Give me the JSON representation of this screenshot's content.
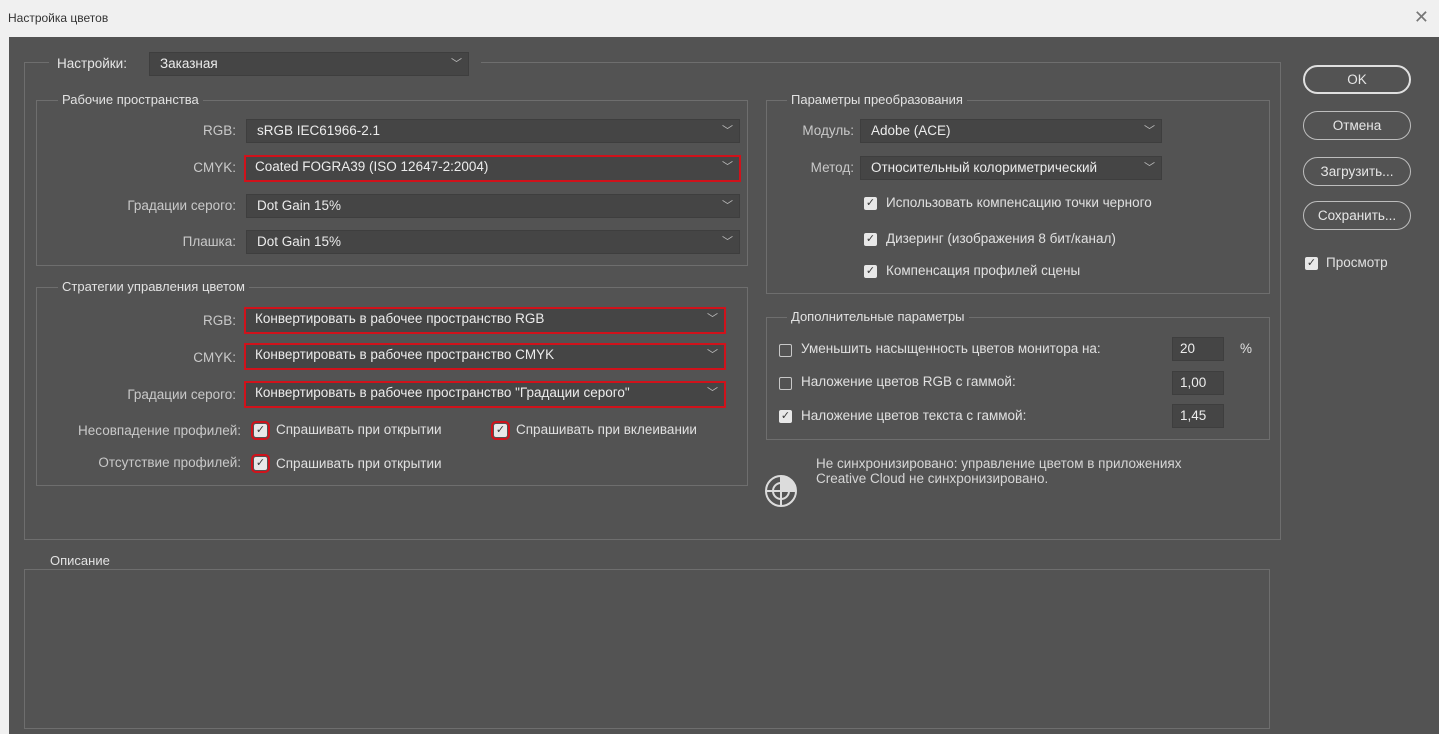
{
  "window": {
    "title": "Настройка цветов"
  },
  "settings": {
    "label": "Настройки:",
    "value": "Заказная"
  },
  "working_spaces": {
    "title": "Рабочие пространства",
    "rgb": {
      "label": "RGB:",
      "value": "sRGB IEC61966-2.1"
    },
    "cmyk": {
      "label": "CMYK:",
      "value": "Coated FOGRA39 (ISO 12647-2:2004)"
    },
    "gray": {
      "label": "Градации серого:",
      "value": "Dot Gain 15%"
    },
    "spot": {
      "label": "Плашка:",
      "value": "Dot Gain 15%"
    }
  },
  "policies": {
    "title": "Стратегии управления цветом",
    "rgb": {
      "label": "RGB:",
      "value": "Конвертировать в рабочее пространство RGB"
    },
    "cmyk": {
      "label": "CMYK:",
      "value": "Конвертировать в рабочее пространство CMYK"
    },
    "gray": {
      "label": "Градации серого:",
      "value": "Конвертировать в рабочее пространство \"Градации серого\""
    },
    "mismatch": {
      "label": "Несовпадение профилей:",
      "ask_open": "Спрашивать при открытии",
      "ask_paste": "Спрашивать при вклеивании"
    },
    "missing": {
      "label": "Отсутствие профилей:",
      "ask_open": "Спрашивать при открытии"
    }
  },
  "conversion": {
    "title": "Параметры преобразования",
    "engine": {
      "label": "Модуль:",
      "value": "Adobe (ACE)"
    },
    "intent": {
      "label": "Метод:",
      "value": "Относительный колориметрический"
    },
    "bpc": "Использовать компенсацию точки черного",
    "dither": "Дизеринг (изображения 8 бит/канал)",
    "scene": "Компенсация профилей сцены"
  },
  "advanced": {
    "title": "Дополнительные параметры",
    "desaturate": {
      "label": "Уменьшить насыщенность цветов монитора на:",
      "value": "20",
      "unit": "%"
    },
    "blend_rgb": {
      "label": "Наложение цветов RGB с гаммой:",
      "value": "1,00"
    },
    "blend_text": {
      "label": "Наложение цветов текста с гаммой:",
      "value": "1,45"
    }
  },
  "sync": {
    "line1": "Не синхронизировано: управление цветом в приложениях",
    "line2": "Creative Cloud не синхронизировано."
  },
  "description": {
    "title": "Описание"
  },
  "buttons": {
    "ok": "OK",
    "cancel": "Отмена",
    "load": "Загрузить...",
    "save": "Сохранить..."
  },
  "preview": {
    "label": "Просмотр"
  },
  "colors": {
    "highlight": "#d0121b",
    "dialog_bg": "#535353",
    "field_bg": "#454545"
  }
}
